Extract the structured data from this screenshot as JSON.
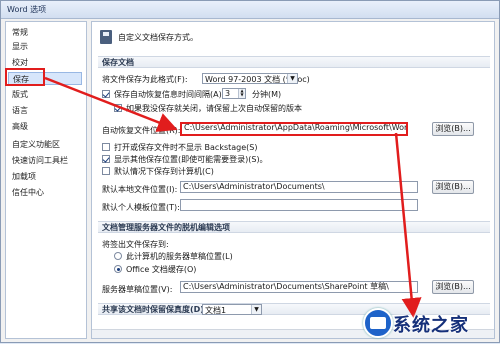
{
  "window": {
    "title": "Word 选项"
  },
  "sidebar": {
    "items": [
      {
        "label": "常规"
      },
      {
        "label": "显示"
      },
      {
        "label": "校对"
      },
      {
        "label": "保存",
        "selected": true
      },
      {
        "label": "版式"
      },
      {
        "label": "语言"
      },
      {
        "label": "高级"
      },
      {
        "label": "自定义功能区"
      },
      {
        "label": "快速访问工具栏"
      },
      {
        "label": "加载项"
      },
      {
        "label": "信任中心"
      }
    ]
  },
  "main": {
    "header": "自定义文档保存方式。",
    "save_docs": {
      "section_title": "保存文档",
      "format_label": "将文件保存为此格式(F):",
      "format_value": "Word 97-2003 文档 (*.doc)",
      "autorecover_label": "保存自动恢复信息时间间隔(A)",
      "autorecover_minutes": "3",
      "minutes_unit": "分钟(M)",
      "keep_last_label": "如果我没保存就关闭，请保留上次自动保留的版本",
      "autorecover_path_label": "自动恢复文件位置(R):",
      "autorecover_path": "C:\\Users\\Administrator\\AppData\\Roaming\\Microsoft\\Word\\",
      "browse_label": "浏览(B)...",
      "backstage_label": "打开或保存文件时不显示 Backstage(S)",
      "show_other_places_label": "显示其他保存位置(即使可能需要登录)(S)。",
      "save_to_computer_label": "默认情况下保存到计算机(C)",
      "default_path_label": "默认本地文件位置(I):",
      "default_path": "C:\\Users\\Administrator\\Documents\\",
      "browse2_label": "浏览(B)...",
      "template_label": "默认个人模板位置(T):",
      "template_path": ""
    },
    "offline": {
      "section_title": "文档管理服务器文件的脱机编辑选项",
      "checkout_label": "将签出文件保存到:",
      "radio1_label": "此计算机的服务器草稿位置(L)",
      "radio2_label": "Office 文档缓存(O)",
      "drafts_label": "服务器草稿位置(V):",
      "drafts_path": "C:\\Users\\Administrator\\Documents\\SharePoint 草稿\\",
      "browse3_label": "浏览(B)..."
    },
    "share": {
      "label": "共享该文档时保留保真度(D):",
      "doc_value": "文档1"
    }
  },
  "watermark": {
    "text": "系统之家"
  },
  "colors": {
    "annotation_red": "#e11d1d",
    "accent_blue": "#1e63c9"
  }
}
